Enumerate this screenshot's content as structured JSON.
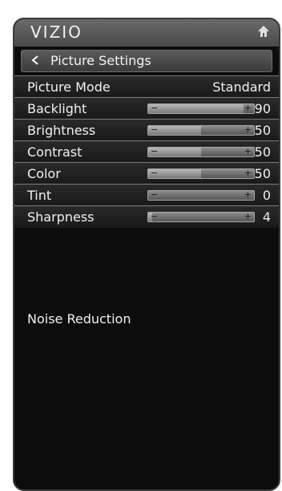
{
  "brand": "VIZIO",
  "header_title": "Picture Settings",
  "rows": [
    {
      "label": "Picture Mode",
      "value": "Standard"
    },
    {
      "label": "Backlight",
      "value": "90",
      "level": 90
    },
    {
      "label": "Brightness",
      "value": "50",
      "level": 50
    },
    {
      "label": "Contrast",
      "value": "50",
      "level": 50
    },
    {
      "label": "Color",
      "value": "50",
      "level": 50
    },
    {
      "label": "Tint",
      "value": "0",
      "level": 0
    },
    {
      "label": "Sharpness",
      "value": "4",
      "level": 4
    }
  ],
  "noise_label": "Noise Reduction",
  "icons": {
    "home": "home-icon",
    "back": "chevron-left-icon"
  }
}
